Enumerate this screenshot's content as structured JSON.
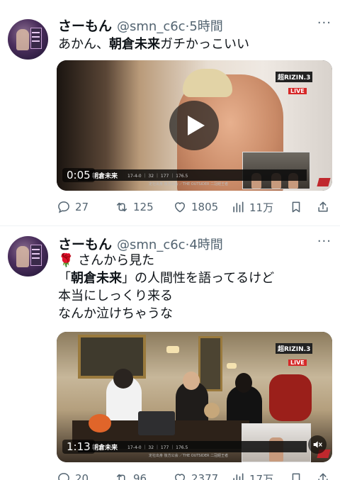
{
  "tweets": [
    {
      "name": "さーもん",
      "handle": "@smn_c6c",
      "time": "·5時間",
      "more": "···",
      "text_lines": [
        {
          "pre": "あかん、",
          "bold": "朝倉未来",
          "post": "ガチかっこいい"
        }
      ],
      "video": {
        "duration": "0:05",
        "overlay_name": "朝倉未来",
        "overlay_stats": "17-4-0 ｜ 32 ｜ 177 ｜ 176.5",
        "overlay_sub": "定社出身 後方公会 ／THE OUTSIDER 二冠経王者",
        "logo_text": "超RIZIN.3",
        "live_label": "LIVE"
      },
      "stats": {
        "replies": "27",
        "retweets": "125",
        "likes": "1805",
        "views": "11万"
      }
    },
    {
      "name": "さーもん",
      "handle": "@smn_c6c",
      "time": "·4時間",
      "more": "···",
      "text_lines": [
        {
          "emoji": "🌹",
          "pre": " さんから見た",
          "bold": "",
          "post": ""
        },
        {
          "pre": "「",
          "bold": "朝倉未来",
          "post": "」の人間性を語ってるけど"
        },
        {
          "pre": "本当にしっくり来る",
          "bold": "",
          "post": ""
        },
        {
          "pre": "なんか泣けちゃうな",
          "bold": "",
          "post": ""
        }
      ],
      "video": {
        "duration": "1:13",
        "overlay_name": "朝倉未来",
        "overlay_stats": "17-4-0 ｜ 32 ｜ 177 ｜ 176.5",
        "overlay_sub": "定社出身 後方公会 ／THE OUTSIDER 二冠経王者",
        "logo_text": "超RIZIN.3",
        "live_label": "LIVE",
        "muted": true
      },
      "stats": {
        "replies": "20",
        "retweets": "96",
        "likes": "2377",
        "views": "17万"
      }
    }
  ],
  "icons": {
    "reply": "reply-icon",
    "retweet": "retweet-icon",
    "like": "heart-icon",
    "views": "views-icon",
    "bookmark": "bookmark-icon",
    "share": "share-icon"
  },
  "colors": {
    "text": "#0f1419",
    "secondary": "#536471",
    "divider": "#eff3f4",
    "live": "#d62828"
  }
}
